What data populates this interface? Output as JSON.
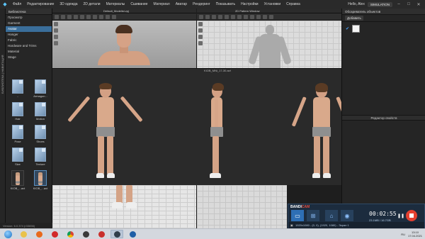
{
  "menubar": {
    "items": [
      "Файл",
      "Редактирование",
      "3D одежда",
      "2D детали",
      "Материалы",
      "Сшивание",
      "Материал",
      "Аватар",
      "Рендеринг",
      "Показывать",
      "Настройки",
      "Установки",
      "Справка"
    ],
    "user": "Hello, Alex",
    "mode": "SIMULATION"
  },
  "vstrip_label": "БИБЛИОТЕКА | НАВИГАЦИЯ",
  "library": {
    "title": "Библиотека",
    "rows": [
      {
        "label": "Просмотр",
        "selected": false
      },
      {
        "label": "Garment",
        "selected": false
      },
      {
        "label": "Avatar",
        "selected": true
      },
      {
        "label": "Hanger",
        "selected": false
      },
      {
        "label": "Fabric",
        "selected": false
      },
      {
        "label": "Hardware and Trims",
        "selected": false
      },
      {
        "label": "Material",
        "selected": false
      },
      {
        "label": "Stage",
        "selected": false
      }
    ],
    "tiles": [
      {
        "label": "..",
        "kind": "folder"
      },
      {
        "label": "Armagon...",
        "kind": "folder"
      },
      {
        "label": "Hair",
        "kind": "folder"
      },
      {
        "label": "Motion",
        "kind": "folder"
      },
      {
        "label": "Pose",
        "kind": "folder"
      },
      {
        "label": "Shoes",
        "kind": "folder"
      },
      {
        "label": "Size",
        "kind": "folder"
      },
      {
        "label": "Texture",
        "kind": "folder"
      },
      {
        "label": "KIOB_...avt",
        "kind": "avatar"
      },
      {
        "label": "KIOB_...avt",
        "kind": "avatar-selected"
      }
    ]
  },
  "views": {
    "top3d_title": "Default_Modelist.zpj",
    "top2d_title": "2D Pattern Window",
    "main_title": "KIOB_MNi_17-30.avt"
  },
  "rpanel": {
    "title": "Обозреватель объектов",
    "add_label": "Добавить",
    "props_title": "Редактор свойств"
  },
  "bandicam": {
    "brand_a": "BANDI",
    "brand_b": "CAM",
    "timer": "00:02:55",
    "size": "23.1MB / 16.7GB",
    "resolution": "1920x1080 - (0, 0), (1920, 1080) - Экран 1"
  },
  "status": "Version: 6.0.374 (r33656)",
  "taskbar": {
    "lang": "RU",
    "time": "13:10",
    "date": "17.04.2021"
  },
  "colors": {
    "selection": "#3a6e9a",
    "accent": "#5cc7ff",
    "record": "#e44030"
  }
}
